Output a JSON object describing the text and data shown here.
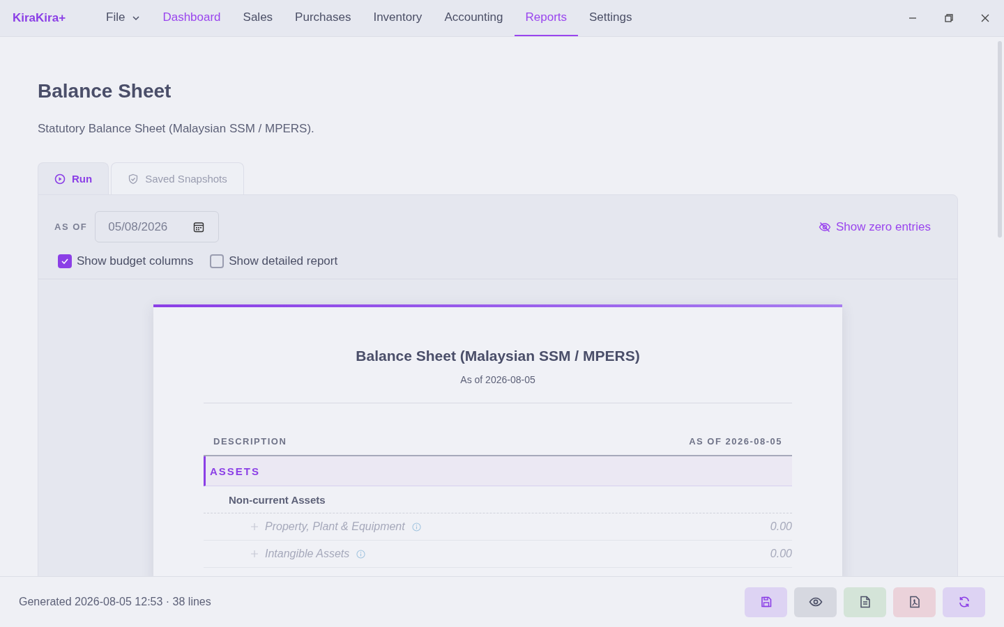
{
  "app": {
    "logo": "KiraKira+"
  },
  "menu": [
    {
      "label": "File",
      "kind": "dropdown",
      "highlighted": false,
      "selected": false
    },
    {
      "label": "Dashboard",
      "kind": "link",
      "highlighted": true,
      "selected": false
    },
    {
      "label": "Sales",
      "kind": "link",
      "highlighted": false,
      "selected": false
    },
    {
      "label": "Purchases",
      "kind": "link",
      "highlighted": false,
      "selected": false
    },
    {
      "label": "Inventory",
      "kind": "link",
      "highlighted": false,
      "selected": false
    },
    {
      "label": "Accounting",
      "kind": "link",
      "highlighted": false,
      "selected": false
    },
    {
      "label": "Reports",
      "kind": "link",
      "highlighted": false,
      "selected": true
    },
    {
      "label": "Settings",
      "kind": "link",
      "highlighted": false,
      "selected": false
    }
  ],
  "page": {
    "title": "Balance Sheet",
    "subtitle": "Statutory Balance Sheet (Malaysian SSM / MPERS)."
  },
  "tabs": [
    {
      "label": "Run",
      "kind": "run",
      "selected": true
    },
    {
      "label": "Saved Snapshots",
      "kind": "snapshots",
      "selected": false
    }
  ],
  "filters": {
    "as_of_label": "AS OF",
    "date": "05/08/2026",
    "show_zero_label": "Show zero entries",
    "checkboxes": [
      {
        "label": "Show budget columns",
        "checked": true
      },
      {
        "label": "Show detailed report",
        "checked": false
      }
    ]
  },
  "report": {
    "title": "Balance Sheet (Malaysian SSM / MPERS)",
    "subtitle": "As of 2026-08-05",
    "columns": [
      "DESCRIPTION",
      "AS OF 2026-08-05"
    ],
    "rows": [
      {
        "kind": "section",
        "label": "ASSETS"
      },
      {
        "kind": "group",
        "label": "Non-current Assets"
      },
      {
        "kind": "account",
        "label": "Property, Plant & Equipment",
        "amount": "0.00"
      },
      {
        "kind": "account",
        "label": "Intangible Assets",
        "amount": "0.00"
      }
    ]
  },
  "status_bar": {
    "text": "Generated 2026-08-05 12:53 · 38 lines",
    "actions": [
      {
        "kind": "save",
        "color": "#ddd3f3"
      },
      {
        "kind": "preview",
        "color": "#d6d8e0"
      },
      {
        "kind": "document",
        "color": "#d4e4d8"
      },
      {
        "kind": "pdf",
        "color": "#ebd2da"
      },
      {
        "kind": "refresh",
        "color": "#ddd3f3"
      }
    ]
  }
}
